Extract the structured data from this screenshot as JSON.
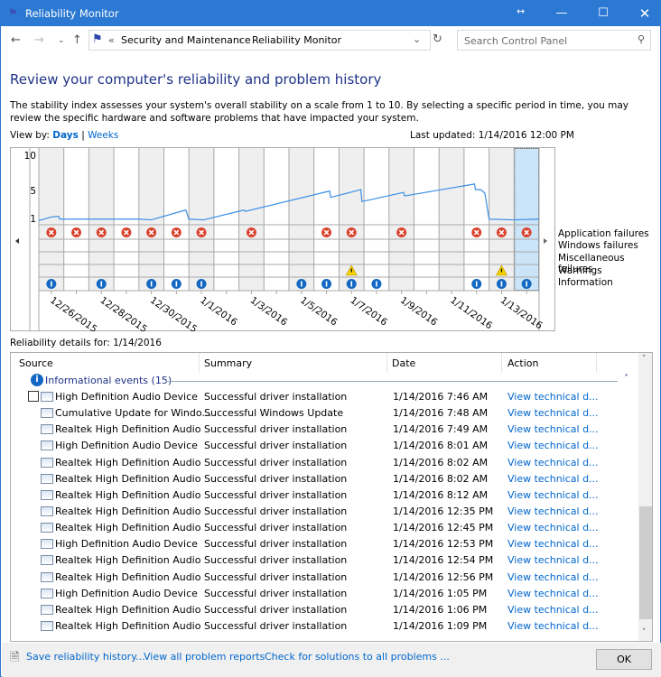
{
  "window": {
    "title": "Reliability Monitor"
  },
  "nav": {
    "breadcrumb": [
      "Security and Maintenance",
      "Reliability Monitor"
    ],
    "search_placeholder": "Search Control Panel"
  },
  "page": {
    "title": "Review your computer's reliability and problem history",
    "description": "The stability index assesses your system's overall stability on a scale from 1 to 10. By selecting a specific period in time, you may review the specific hardware and software problems that have impacted your system.",
    "view_by_label": "View by:",
    "view_days": "Days",
    "view_sep": "|",
    "view_weeks": "Weeks",
    "last_updated": "Last updated: 1/14/2016 12:00 PM",
    "details_for": "Reliability details for: 1/14/2016"
  },
  "chart_data": {
    "type": "line",
    "y_ticks": [
      "10",
      "5",
      "1"
    ],
    "ylim": [
      1,
      10
    ],
    "days": [
      "12/26/2015",
      "12/27/2015",
      "12/28/2015",
      "12/29/2015",
      "12/30/2015",
      "12/31/2015",
      "1/1/2016",
      "1/2/2016",
      "1/3/2016",
      "1/4/2016",
      "1/5/2016",
      "1/6/2016",
      "1/7/2016",
      "1/8/2016",
      "1/9/2016",
      "1/10/2016",
      "1/11/2016",
      "1/12/2016",
      "1/13/2016",
      "1/14/2016"
    ],
    "x_labels": [
      "12/26/2015",
      "12/28/2015",
      "12/30/2015",
      "1/1/2016",
      "1/3/2016",
      "1/5/2016",
      "1/7/2016",
      "1/9/2016",
      "1/11/2016",
      "1/13/2016"
    ],
    "selected_day": "1/14/2016",
    "stability_index": [
      [
        "2015-12-26T00:00",
        0.7
      ],
      [
        "2015-12-26T12:00",
        1.2
      ],
      [
        "2015-12-26T19:00",
        1.3
      ],
      [
        "2015-12-26T20:00",
        0.9
      ],
      [
        "2015-12-30T00:00",
        0.9
      ],
      [
        "2015-12-30T12:00",
        0.8
      ],
      [
        "2015-12-31T21:00",
        2.2
      ],
      [
        "2016-01-01T00:00",
        0.9
      ],
      [
        "2016-01-01T14:00",
        0.8
      ],
      [
        "2016-01-03T05:00",
        2.2
      ],
      [
        "2016-01-03T06:00",
        2.0
      ],
      [
        "2016-01-06T15:00",
        4.9
      ],
      [
        "2016-01-06T16:00",
        4.0
      ],
      [
        "2016-01-07T21:00",
        5.1
      ],
      [
        "2016-01-07T22:00",
        3.4
      ],
      [
        "2016-01-09T14:00",
        4.7
      ],
      [
        "2016-01-09T15:00",
        4.2
      ],
      [
        "2016-01-12T10:00",
        5.9
      ],
      [
        "2016-01-12T11:00",
        5.1
      ],
      [
        "2016-01-12T16:00",
        5.1
      ],
      [
        "2016-01-12T20:00",
        4.6
      ],
      [
        "2016-01-13T00:00",
        0.9
      ],
      [
        "2016-01-14T00:00",
        0.8
      ],
      [
        "2016-01-15T00:00",
        0.9
      ]
    ],
    "event_rows": [
      {
        "name": "Application failures",
        "icon": "error",
        "days": [
          "12/26/2015",
          "12/27/2015",
          "12/28/2015",
          "12/29/2015",
          "12/30/2015",
          "12/31/2015",
          "1/1/2016",
          "1/3/2016",
          "1/6/2016",
          "1/7/2016",
          "1/9/2016",
          "1/12/2016",
          "1/13/2016",
          "1/14/2016"
        ]
      },
      {
        "name": "Windows failures",
        "icon": "error",
        "days": []
      },
      {
        "name": "Miscellaneous failures",
        "icon": "error",
        "days": []
      },
      {
        "name": "Warnings",
        "icon": "warning",
        "days": [
          "1/7/2016",
          "1/13/2016"
        ]
      },
      {
        "name": "Information",
        "icon": "info",
        "days": [
          "12/26/2015",
          "12/28/2015",
          "12/30/2015",
          "12/31/2015",
          "1/1/2016",
          "1/5/2016",
          "1/6/2016",
          "1/7/2016",
          "1/8/2016",
          "1/12/2016",
          "1/13/2016",
          "1/14/2016"
        ]
      }
    ],
    "colors": {
      "line": "#3a8ee6",
      "error": "#d9412b",
      "warning": "#f5d000",
      "info": "#1368c4",
      "selected": "#cce4f7",
      "shade": "#efefef"
    }
  },
  "table": {
    "columns": [
      "Source",
      "Summary",
      "Date",
      "Action"
    ],
    "group": "Informational events (15)",
    "rows": [
      [
        "High Definition Audio Device",
        "Successful driver installation",
        "1/14/2016 7:46 AM",
        "View  technical d..."
      ],
      [
        "Cumulative Update for Windo...",
        "Successful Windows Update",
        "1/14/2016 7:48 AM",
        "View  technical d..."
      ],
      [
        "Realtek High Definition Audio",
        "Successful driver installation",
        "1/14/2016 7:49 AM",
        "View  technical d..."
      ],
      [
        "High Definition Audio Device",
        "Successful driver installation",
        "1/14/2016 8:01 AM",
        "View  technical d..."
      ],
      [
        "Realtek High Definition Audio",
        "Successful driver installation",
        "1/14/2016 8:02 AM",
        "View  technical d..."
      ],
      [
        "Realtek High Definition Audio",
        "Successful driver installation",
        "1/14/2016 8:02 AM",
        "View  technical d..."
      ],
      [
        "Realtek High Definition Audio",
        "Successful driver installation",
        "1/14/2016 8:12 AM",
        "View  technical d..."
      ],
      [
        "Realtek High Definition Audio",
        "Successful driver installation",
        "1/14/2016 12:35 PM",
        "View  technical d..."
      ],
      [
        "Realtek High Definition Audio",
        "Successful driver installation",
        "1/14/2016 12:45 PM",
        "View  technical d..."
      ],
      [
        "High Definition Audio Device",
        "Successful driver installation",
        "1/14/2016 12:53 PM",
        "View  technical d..."
      ],
      [
        "Realtek High Definition Audio",
        "Successful driver installation",
        "1/14/2016 12:54 PM",
        "View  technical d..."
      ],
      [
        "Realtek High Definition Audio",
        "Successful driver installation",
        "1/14/2016 12:56 PM",
        "View  technical d..."
      ],
      [
        "High Definition Audio Device",
        "Successful driver installation",
        "1/14/2016 1:05 PM",
        "View  technical d..."
      ],
      [
        "Realtek High Definition Audio",
        "Successful driver installation",
        "1/14/2016 1:06 PM",
        "View  technical d..."
      ],
      [
        "Realtek High Definition Audio",
        "Successful driver installation",
        "1/14/2016 1:09 PM",
        "View  technical d..."
      ]
    ]
  },
  "footer": {
    "save": "Save reliability history...",
    "view_all": "View all problem reports",
    "check": "Check for solutions to all problems ...",
    "ok": "OK"
  }
}
